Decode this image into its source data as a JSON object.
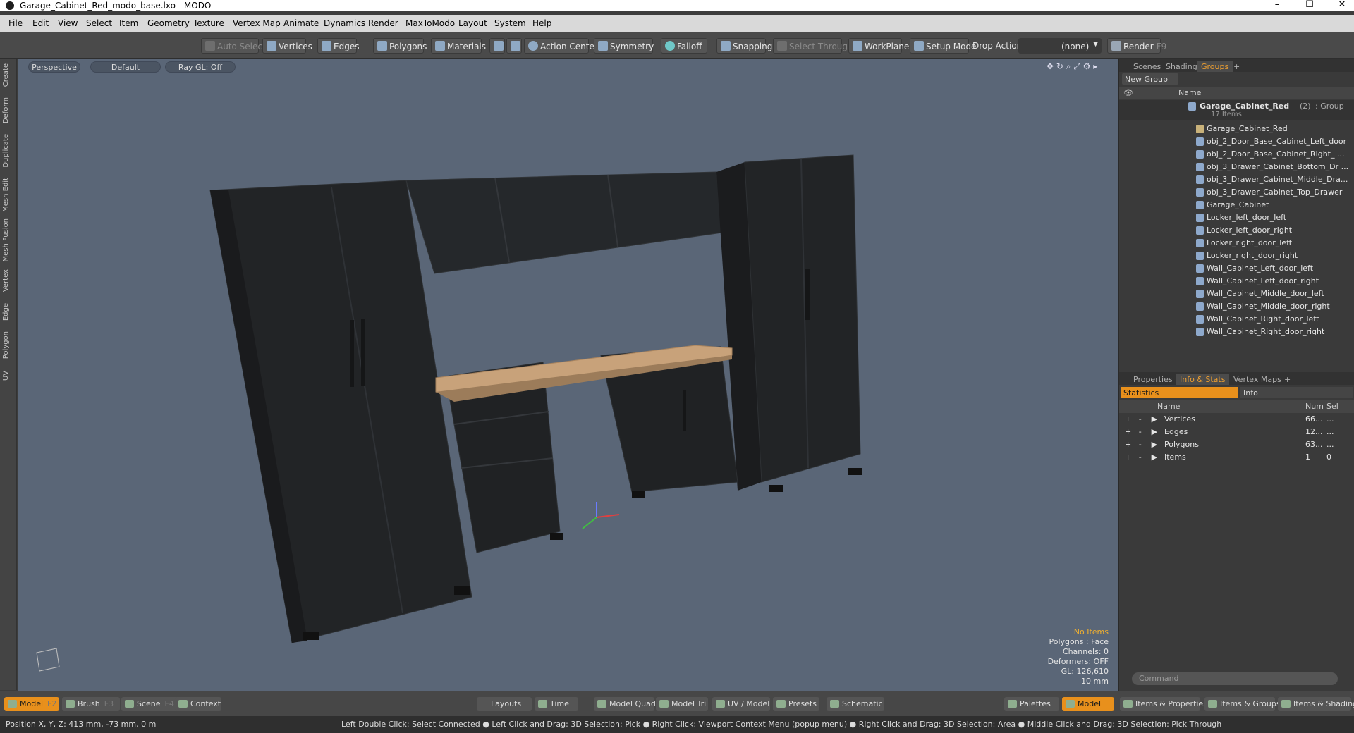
{
  "window": {
    "title": "Garage_Cabinet_Red_modo_base.lxo - MODO",
    "minimize": "–",
    "maximize": "☐",
    "close": "✕"
  },
  "menu": [
    "File",
    "Edit",
    "View",
    "Select",
    "Item",
    "Geometry",
    "Texture",
    "Vertex Map",
    "Animate",
    "Dynamics",
    "Render",
    "MaxToModo",
    "Layout",
    "System",
    "Help"
  ],
  "toolbar": {
    "auto_select": "Auto Select",
    "vertices": "Vertices",
    "edges": "Edges",
    "polygons": "Polygons",
    "materials": "Materials",
    "action_center": "Action Center",
    "symmetry": "Symmetry",
    "falloff": "Falloff",
    "snapping": "Snapping",
    "select_through": "Select Through",
    "workplane": "WorkPlane",
    "setup_mode": "Setup Mode",
    "drop_action_label": "Drop Action",
    "drop_action_value": "(none)",
    "render": "Render",
    "render_key": "F9"
  },
  "left_tabs": [
    "Create",
    "Deform",
    "Duplicate",
    "Mesh Edit",
    "Mesh Fusion",
    "Vertex",
    "Edge",
    "Polygon",
    "UV"
  ],
  "viewport": {
    "view": "Perspective",
    "shading": "Default",
    "raygl": "Ray GL: Off",
    "hud": {
      "items": "No Items",
      "polygons": "Polygons : Face",
      "channels": "Channels: 0",
      "deformers": "Deformers: OFF",
      "gl": "GL: 126,610",
      "grid": "10 mm"
    },
    "colors": {
      "background": "#5a6677",
      "cabinet": "#222426",
      "counter": "#c8a27a"
    }
  },
  "scene_panel": {
    "tabs": [
      "Scenes",
      "Shading",
      "Groups"
    ],
    "active_tab": "Groups",
    "new_group": "New Group",
    "col_name": "Name",
    "group": {
      "name": "Garage_Cabinet_Red",
      "count": "(2)",
      "type": ": Group",
      "subtitle": "17 Items"
    },
    "items": [
      "Garage_Cabinet_Red",
      "obj_2_Door_Base_Cabinet_Left_door",
      "obj_2_Door_Base_Cabinet_Right_ ...",
      "obj_3_Drawer_Cabinet_Bottom_Dr ...",
      "obj_3_Drawer_Cabinet_Middle_Dra...",
      "obj_3_Drawer_Cabinet_Top_Drawer",
      "Garage_Cabinet",
      "Locker_left_door_left",
      "Locker_left_door_right",
      "Locker_right_door_left",
      "Locker_right_door_right",
      "Wall_Cabinet_Left_door_left",
      "Wall_Cabinet_Left_door_right",
      "Wall_Cabinet_Middle_door_left",
      "Wall_Cabinet_Middle_door_right",
      "Wall_Cabinet_Right_door_left",
      "Wall_Cabinet_Right_door_right"
    ]
  },
  "props_panel": {
    "tabs": [
      "Properties",
      "Info & Stats",
      "Vertex Maps"
    ],
    "active_tab": "Info & Stats",
    "subtabs": [
      "Statistics",
      "Info"
    ],
    "columns": [
      "Name",
      "Num",
      "Sel"
    ],
    "rows": [
      {
        "name": "Vertices",
        "num": "66...",
        "sel": "..."
      },
      {
        "name": "Edges",
        "num": "12...",
        "sel": "..."
      },
      {
        "name": "Polygons",
        "num": "63...",
        "sel": "..."
      },
      {
        "name": "Items",
        "num": "1",
        "sel": "0"
      }
    ],
    "command_placeholder": "Command"
  },
  "bottom_tabs": {
    "model": "Model",
    "model_key": "F2",
    "brush": "Brush",
    "brush_key": "F3",
    "scene": "Scene",
    "scene_key": "F4",
    "context": "Context",
    "layouts": "Layouts",
    "time": "Time",
    "model_quad": "Model Quad",
    "model_tri": "Model Tri",
    "uv_model": "UV / Model",
    "presets": "Presets",
    "schematic": "Schematic",
    "palettes": "Palettes",
    "model2": "Model",
    "items_props": "Items & Properties",
    "items_groups": "Items & Groups",
    "items_shading": "Items & Shading"
  },
  "status": {
    "position": "Position X, Y, Z:   413 mm, -73 mm, 0 m",
    "hints": "Left Double Click: Select Connected ● Left Click and Drag: 3D Selection: Pick ● Right Click: Viewport Context Menu (popup menu) ● Right Click and Drag: 3D Selection: Area ● Middle Click and Drag: 3D Selection: Pick Through"
  }
}
